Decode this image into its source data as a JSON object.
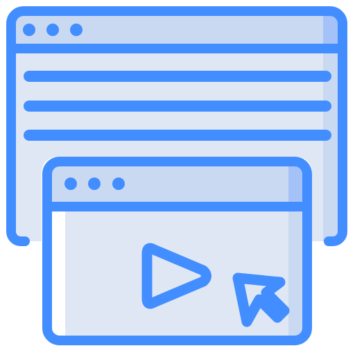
{
  "illustration": {
    "subject": "web-video-player-icon",
    "icons": {
      "back_window": "browser-window-icon",
      "front_window": "video-player-window-icon",
      "play": "play-icon",
      "cursor": "cursor-arrow-icon"
    },
    "colors": {
      "stroke": "#428DFF",
      "content_fill": "#DFE7F4",
      "titlebar_fill": "#CAD9F2",
      "accent_fill": "#A4C2F7",
      "highlight": "#FFFFFF"
    }
  }
}
